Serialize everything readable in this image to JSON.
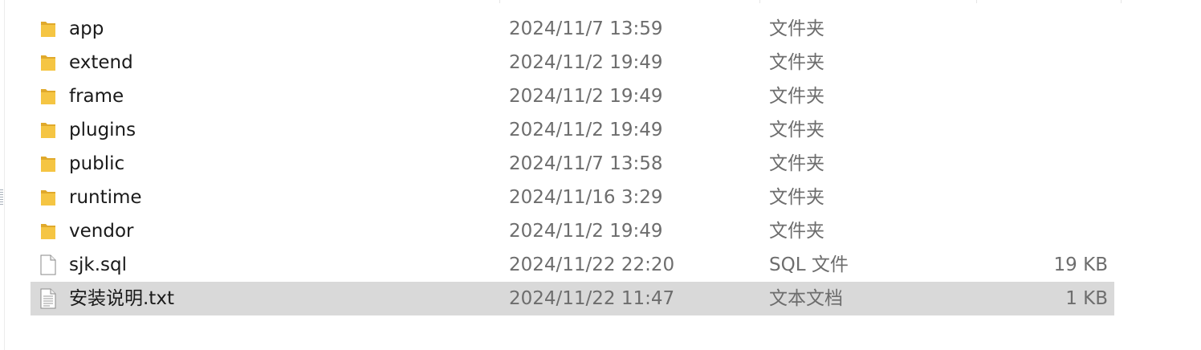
{
  "files": [
    {
      "name": "app",
      "date": "2024/11/7 13:59",
      "type": "文件夹",
      "size": "",
      "icon": "folder-icon",
      "selected": false
    },
    {
      "name": "extend",
      "date": "2024/11/2 19:49",
      "type": "文件夹",
      "size": "",
      "icon": "folder-icon",
      "selected": false
    },
    {
      "name": "frame",
      "date": "2024/11/2 19:49",
      "type": "文件夹",
      "size": "",
      "icon": "folder-icon",
      "selected": false
    },
    {
      "name": "plugins",
      "date": "2024/11/2 19:49",
      "type": "文件夹",
      "size": "",
      "icon": "folder-icon",
      "selected": false
    },
    {
      "name": "public",
      "date": "2024/11/7 13:58",
      "type": "文件夹",
      "size": "",
      "icon": "folder-icon",
      "selected": false
    },
    {
      "name": "runtime",
      "date": "2024/11/16 3:29",
      "type": "文件夹",
      "size": "",
      "icon": "folder-icon",
      "selected": false
    },
    {
      "name": "vendor",
      "date": "2024/11/2 19:49",
      "type": "文件夹",
      "size": "",
      "icon": "folder-icon",
      "selected": false
    },
    {
      "name": "sjk.sql",
      "date": "2024/11/22 22:20",
      "type": "SQL 文件",
      "size": "19 KB",
      "icon": "file-icon",
      "selected": false
    },
    {
      "name": "安装说明.txt",
      "date": "2024/11/22 11:47",
      "type": "文本文档",
      "size": "1 KB",
      "icon": "text-file-icon",
      "selected": true
    }
  ],
  "colors": {
    "folder": "#f5c543",
    "folder_dark": "#e0a92b",
    "selected_row": "#d9d9d9",
    "secondary_text": "#6d6d6d"
  }
}
